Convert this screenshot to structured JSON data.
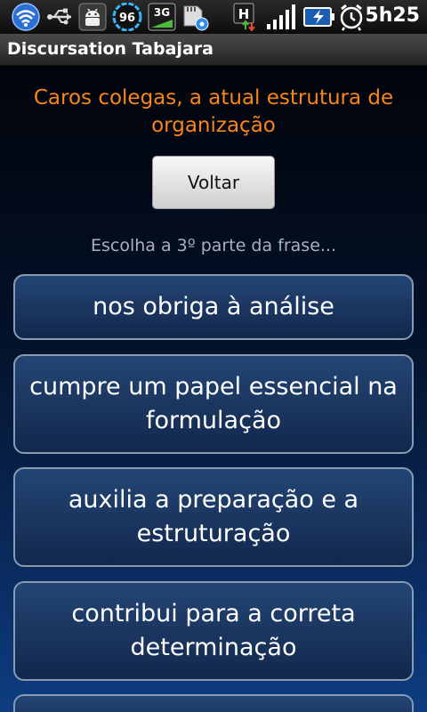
{
  "status_bar": {
    "icons": [
      "wifi-icon",
      "usb-icon",
      "android-debug-icon",
      "battery-widget-icon",
      "3g-data-icon",
      "sd-card-settings-icon",
      "hspa-data-icon",
      "signal-icon",
      "battery-charging-icon",
      "alarm-icon"
    ],
    "battery_widget_value": "96",
    "network_label": "3G",
    "hspa_label": "H",
    "time": "5h25"
  },
  "app": {
    "title": "Discursation Tabajara"
  },
  "main": {
    "heading": "Caros colegas, a atual estrutura de organização",
    "back_label": "Voltar",
    "prompt": "Escolha a 3º parte da frase...",
    "options": [
      {
        "label": "nos obriga à análise"
      },
      {
        "label": "cumpre um papel essencial na formulação"
      },
      {
        "label": "auxilia a preparação e a estruturação"
      },
      {
        "label": "contribui para a correta determinação"
      },
      {
        "label": ""
      }
    ]
  },
  "colors": {
    "heading": "#f7851c",
    "prompt": "#a9b0ba",
    "button_border": "#8a9bb1",
    "background_top": "#01040b",
    "background_bottom": "#0d3e82"
  }
}
